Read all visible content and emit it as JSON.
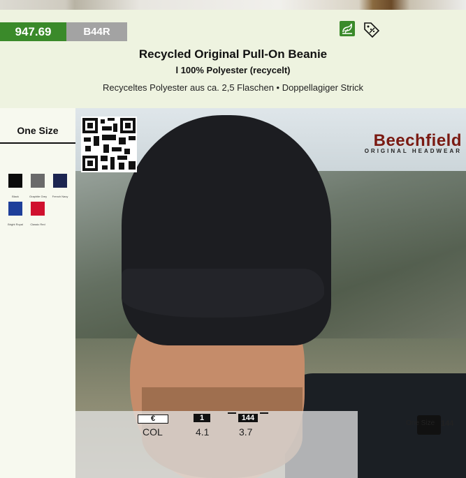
{
  "header": {
    "price": "947.69",
    "sku": "B44R",
    "title": "Recycled Original Pull-On Beanie",
    "material": "l 100% Polyester (recycelt)",
    "features": "Recyceltes Polyester aus ca. 2,5 Flaschen • Doppellagiger Strick",
    "icons": [
      "recycle-leaf-icon",
      "tag-percent-icon"
    ],
    "accent_color": "#3a8a2a"
  },
  "sidebar": {
    "size_label": "One Size",
    "swatches": [
      {
        "name": "Black",
        "color": "#0b0b0b"
      },
      {
        "name": "Graphite Grey",
        "color": "#6a6a6a"
      },
      {
        "name": "French Navy",
        "color": "#1c2550"
      },
      {
        "name": "Bright Royal",
        "color": "#1f3f9a"
      },
      {
        "name": "Classic Red",
        "color": "#d0102e"
      }
    ]
  },
  "brand": {
    "name": "Beechfield",
    "tagline": "ORIGINAL HEADWEAR"
  },
  "info": {
    "currency": "€",
    "qty_1": "1",
    "qty_144": "144",
    "col_label": "COL",
    "price_1": "4.1",
    "price_144": "3.7"
  },
  "stock": {
    "size": "One Size",
    "qty": "144"
  }
}
